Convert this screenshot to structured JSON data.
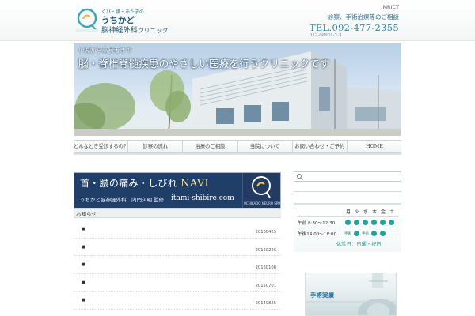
{
  "header": {
    "mrict": "MRICT",
    "logo_tagline": "くび・腰・あたまの",
    "logo_name_line1": "うちかど",
    "logo_name_line2": "脳神経外科",
    "logo_name_line2_suffix": "クリニック",
    "contact_note": "診察、手術治療等のご相談",
    "tel": "TEL.092-477-2355",
    "tel_small": "012-08931-2-3"
  },
  "hero": {
    "caption": "小児から高齢者まで",
    "title": "脳・脊椎脊髄疾患のやさしい医療を行うクリニックです"
  },
  "nav": {
    "items": [
      {
        "label": "どんなとき受診するの？"
      },
      {
        "label": "診察の流れ"
      },
      {
        "label": "治療のご相談"
      },
      {
        "label": "当院について"
      },
      {
        "label": "お問い合わせ・ご予約"
      },
      {
        "label": "HOME"
      }
    ]
  },
  "banner": {
    "title": "首・腰の痛み・しびれ",
    "navi": "NAVI",
    "sub": "うちかど脳神経外科　内門久明 監修",
    "url": "itami-shibire.com",
    "badge_text": "UCHIKADO NEURO SPINE CLINIC"
  },
  "news": {
    "heading": "お知らせ",
    "items": [
      {
        "bullet": "■",
        "date": "20160425"
      },
      {
        "bullet": "■",
        "date": "20160226"
      },
      {
        "bullet": "■",
        "date": "20160108"
      },
      {
        "bullet": "■",
        "date": "20150701"
      },
      {
        "bullet": "■",
        "date": "20140825"
      }
    ]
  },
  "sidebar": {
    "search_placeholder": "",
    "hours": {
      "days": [
        "月",
        "火",
        "水",
        "木",
        "金",
        "土"
      ],
      "am_label": "午前  8:30～12:30",
      "pm_label": "午後14:00～18:00",
      "am_marks": [
        "dot",
        "dot",
        "dot",
        "dot",
        "dot",
        "dot"
      ],
      "pm_marks": [
        "手術",
        "dot",
        "手術",
        "dot",
        "dot",
        ""
      ],
      "holiday": "休診日：日曜・祝日",
      "accent": "#23a399"
    },
    "card_title": "手術実績"
  }
}
